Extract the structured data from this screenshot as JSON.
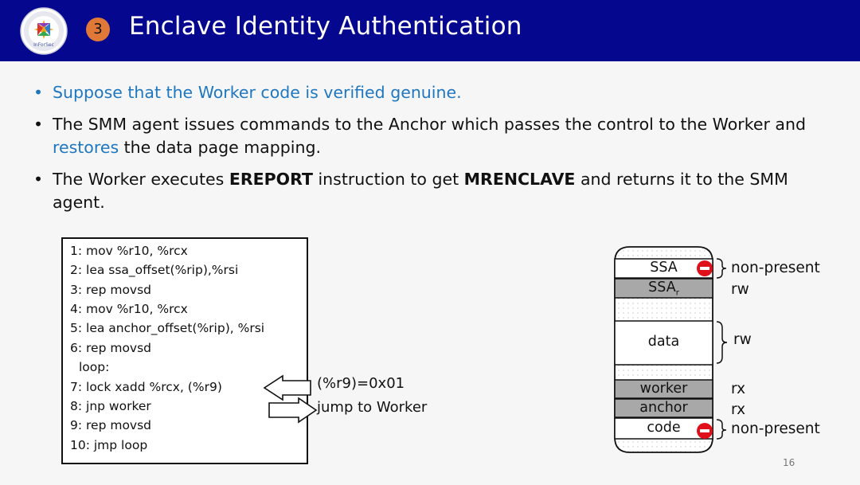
{
  "header": {
    "slide_number": "3",
    "title": "Enclave Identity Authentication",
    "logo_text": "InForSec"
  },
  "bullets": [
    {
      "parts": [
        "Suppose that the Worker code is verified genuine."
      ]
    },
    {
      "parts": [
        "The SMM agent issues commands to the Anchor which passes the control to the Worker and ",
        "restores",
        " the data page mapping."
      ]
    },
    {
      "parts": [
        "The Worker executes ",
        "EREPORT",
        " instruction to get ",
        "MRENCLAVE",
        " and returns it to the SMM agent."
      ]
    }
  ],
  "code": [
    "1:   mov %r10, %rcx",
    "2:   lea ssa_offset(%rip),%rsi",
    "3:   rep movsd",
    "4:   mov %r10, %rcx",
    "5:   lea anchor_offset(%rip), %rsi",
    "6:   rep movsd",
    "loop:",
    "7:   lock xadd %rcx, (%r9)",
    "8:   jnp worker",
    "9:   rep movsd",
    "10:  jmp loop"
  ],
  "annotations": {
    "r9_value": "(%r9)=0x01",
    "jump": "jump to Worker"
  },
  "memory": {
    "cells": [
      "SSA",
      "SSA",
      "data",
      "worker",
      "anchor",
      "code"
    ],
    "ssa_r_subscript": "r",
    "labels": {
      "ssa": "non-present",
      "ssa_r": "rw",
      "data": "rw",
      "worker": "rx",
      "anchor": "rx",
      "code": "non-present"
    }
  },
  "page_number": "16",
  "colors": {
    "header_bg": "#05088f",
    "accent_blue": "#1f77c0",
    "badge": "#e07838",
    "gray_cell": "#a8a8a8",
    "stop_red": "#e0101a"
  }
}
